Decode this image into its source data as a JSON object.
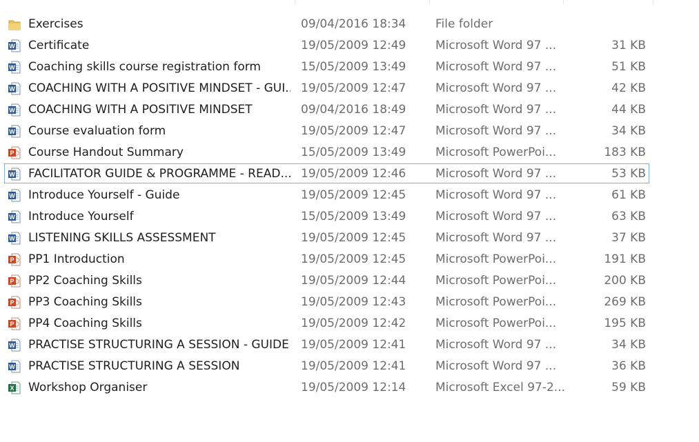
{
  "files": [
    {
      "name": "Exercises",
      "date": "09/04/2016 18:34",
      "type": "File folder",
      "size": "",
      "icon": "folder-icon"
    },
    {
      "name": "Certificate",
      "date": "19/05/2009 12:49",
      "type": "Microsoft Word 97 ...",
      "size": "31 KB",
      "icon": "word-icon"
    },
    {
      "name": "Coaching skills course registration form",
      "date": "15/05/2009 13:49",
      "type": "Microsoft Word 97 ...",
      "size": "51 KB",
      "icon": "word-icon"
    },
    {
      "name": "COACHING WITH A POSITIVE MINDSET - GUI...",
      "date": "19/05/2009 12:47",
      "type": "Microsoft Word 97 ...",
      "size": "42 KB",
      "icon": "word-icon"
    },
    {
      "name": "COACHING WITH A POSITIVE MINDSET",
      "date": "09/04/2016 18:49",
      "type": "Microsoft Word 97 ...",
      "size": "44 KB",
      "icon": "word-icon"
    },
    {
      "name": "Course evaluation form",
      "date": "19/05/2009 12:47",
      "type": "Microsoft Word 97 ...",
      "size": "34 KB",
      "icon": "word-icon"
    },
    {
      "name": "Course Handout Summary",
      "date": "15/05/2009 13:49",
      "type": "Microsoft PowerPoi...",
      "size": "183 KB",
      "icon": "powerpoint-icon"
    },
    {
      "name": "FACILITATOR GUIDE & PROGRAMME - READ...",
      "date": "19/05/2009 12:46",
      "type": "Microsoft Word 97 ...",
      "size": "53 KB",
      "icon": "word-icon",
      "selected": true
    },
    {
      "name": "Introduce Yourself - Guide",
      "date": "19/05/2009 12:45",
      "type": "Microsoft Word 97 ...",
      "size": "61 KB",
      "icon": "word-icon"
    },
    {
      "name": "Introduce Yourself",
      "date": "15/05/2009 13:49",
      "type": "Microsoft Word 97 ...",
      "size": "63 KB",
      "icon": "word-icon"
    },
    {
      "name": "LISTENING SKILLS ASSESSMENT",
      "date": "19/05/2009 12:45",
      "type": "Microsoft Word 97 ...",
      "size": "37 KB",
      "icon": "word-icon"
    },
    {
      "name": "PP1 Introduction",
      "date": "19/05/2009 12:45",
      "type": "Microsoft PowerPoi...",
      "size": "191 KB",
      "icon": "powerpoint-icon"
    },
    {
      "name": "PP2 Coaching Skills",
      "date": "19/05/2009 12:44",
      "type": "Microsoft PowerPoi...",
      "size": "200 KB",
      "icon": "powerpoint-icon"
    },
    {
      "name": "PP3 Coaching Skills",
      "date": "19/05/2009 12:43",
      "type": "Microsoft PowerPoi...",
      "size": "269 KB",
      "icon": "powerpoint-icon"
    },
    {
      "name": "PP4 Coaching Skills",
      "date": "19/05/2009 12:42",
      "type": "Microsoft PowerPoi...",
      "size": "195 KB",
      "icon": "powerpoint-icon"
    },
    {
      "name": "PRACTISE STRUCTURING A SESSION - GUIDE",
      "date": "19/05/2009 12:41",
      "type": "Microsoft Word 97 ...",
      "size": "34 KB",
      "icon": "word-icon"
    },
    {
      "name": "PRACTISE STRUCTURING A SESSION",
      "date": "19/05/2009 12:41",
      "type": "Microsoft Word 97 ...",
      "size": "36 KB",
      "icon": "word-icon"
    },
    {
      "name": "Workshop Organiser",
      "date": "19/05/2009 12:14",
      "type": "Microsoft Excel 97-2...",
      "size": "59 KB",
      "icon": "excel-icon"
    }
  ],
  "colors": {
    "selection_border": "#7fb0e0",
    "name_text": "#1e1e1e",
    "detail_text": "#6d6d6d",
    "word_blue": "#2b5797",
    "powerpoint_red": "#c8482a",
    "excel_green": "#1f7244",
    "folder_yellow": "#e8c25a"
  }
}
